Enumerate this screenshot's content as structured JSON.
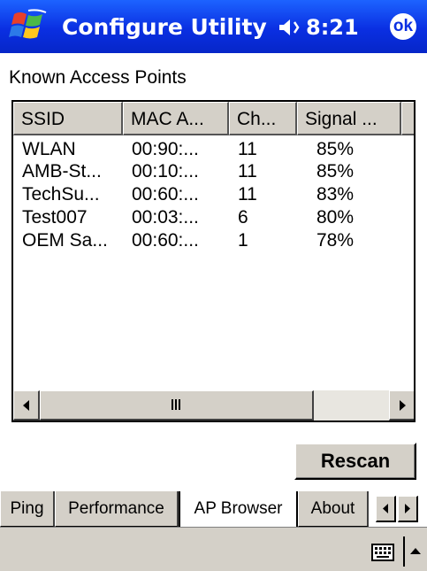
{
  "window": {
    "title": "Configure Utility",
    "clock": "8:21",
    "ok_label": "ok"
  },
  "section_title": "Known Access Points",
  "table": {
    "columns": [
      "SSID",
      "MAC A...",
      "Ch...",
      "Signal ..."
    ],
    "rows": [
      [
        "WLAN",
        "00:90:...",
        "11",
        "85%"
      ],
      [
        "AMB-St...",
        "00:10:...",
        "11",
        "85%"
      ],
      [
        "TechSu...",
        "00:60:...",
        "11",
        "83%"
      ],
      [
        "Test007",
        "00:03:...",
        "6",
        "80%"
      ],
      [
        "OEM Sa...",
        "00:60:...",
        "1",
        "78%"
      ]
    ]
  },
  "buttons": {
    "rescan": "Rescan"
  },
  "tabs": [
    {
      "label": "Ping",
      "active": false
    },
    {
      "label": "Performance",
      "active": false
    },
    {
      "label": "AP Browser",
      "active": true
    },
    {
      "label": "About",
      "active": false
    }
  ],
  "icons": [
    "windows-start-icon",
    "speaker-icon",
    "keyboard-icon",
    "sip-up-arrow-icon",
    "scroll-left-icon",
    "scroll-right-icon",
    "tab-left-icon",
    "tab-right-icon"
  ],
  "colors": {
    "titlebar": "#0a2fe2",
    "chrome": "#d4d0c8"
  }
}
